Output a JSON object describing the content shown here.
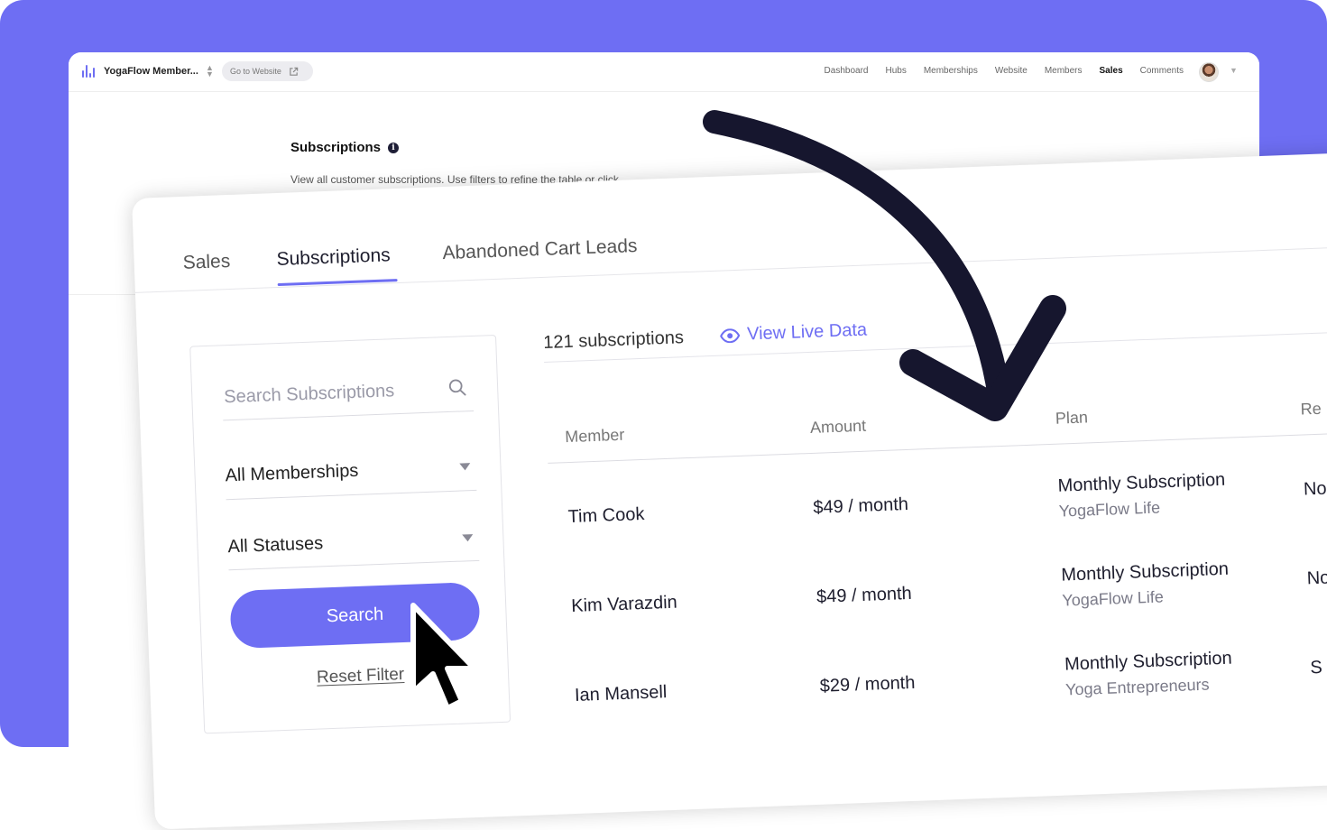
{
  "app": {
    "title": "YogaFlow Member...",
    "go_website": "Go to Website",
    "nav": [
      "Dashboard",
      "Hubs",
      "Memberships",
      "Website",
      "Members",
      "Sales",
      "Comments"
    ],
    "active_nav": "Sales"
  },
  "page": {
    "title": "Subscriptions",
    "description": "View all customer subscriptions. Use filters to refine the table or click"
  },
  "tabs": [
    {
      "label": "Sales"
    },
    {
      "label": "Subscriptions"
    },
    {
      "label": "Abandoned Cart Leads"
    }
  ],
  "active_tab": "Subscriptions",
  "filters": {
    "search_placeholder": "Search Subscriptions",
    "membership_select": "All Memberships",
    "status_select": "All Statuses",
    "search_button": "Search",
    "reset_filter": "Reset Filter"
  },
  "summary": {
    "count": "121 subscriptions",
    "view_live": "View Live Data"
  },
  "table": {
    "columns": [
      "Member",
      "Amount",
      "Plan",
      "Re"
    ],
    "rows": [
      {
        "member": "Tim Cook",
        "amount": "$49 / month",
        "plan": "Monthly Subscription",
        "plan_sub": "YogaFlow Life",
        "extra": "No"
      },
      {
        "member": "Kim Varazdin",
        "amount": "$49 / month",
        "plan": "Monthly Subscription",
        "plan_sub": "YogaFlow Life",
        "extra": "No"
      },
      {
        "member": "Ian Mansell",
        "amount": "$29 / month",
        "plan": "Monthly Subscription",
        "plan_sub": "Yoga Entrepreneurs",
        "extra": "S"
      }
    ]
  },
  "colors": {
    "accent": "#6e6ef3",
    "arrow": "#16162e"
  },
  "icons": [
    "logo-bars-icon",
    "sort-arrows-icon",
    "external-link-icon",
    "info-icon",
    "search-icon",
    "caret-down-icon",
    "eye-icon",
    "curved-arrow-icon",
    "mouse-cursor-icon"
  ]
}
